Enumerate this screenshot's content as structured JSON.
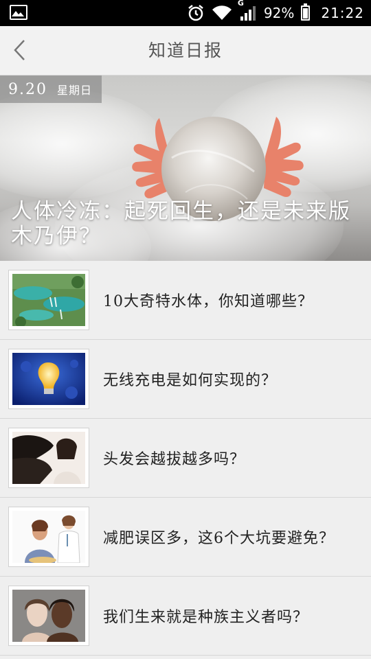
{
  "status_bar": {
    "network_type": "G",
    "battery_percent": "92%",
    "time": "21:22",
    "battery_level": 0.92,
    "icons": [
      "gallery-icon",
      "alarm-icon",
      "wifi-icon",
      "signal-icon",
      "battery-icon"
    ]
  },
  "header": {
    "title": "知道日报",
    "back_icon": "chevron-left-icon"
  },
  "hero": {
    "date": "9.20",
    "weekday": "星期日",
    "headline": "人体冷冻：起死回生，还是未来版木乃伊？"
  },
  "articles": [
    {
      "title": "10大奇特水体，你知道哪些？",
      "thumb": "waterfall-lakes"
    },
    {
      "title": "无线充电是如何实现的？",
      "thumb": "light-bulb"
    },
    {
      "title": "头发会越拔越多吗？",
      "thumb": "long-hair-woman"
    },
    {
      "title": "减肥误区多，这6个大坑要避免？",
      "thumb": "doctor-patient"
    },
    {
      "title": "我们生来就是种族主义者吗？",
      "thumb": "two-faces"
    }
  ]
}
